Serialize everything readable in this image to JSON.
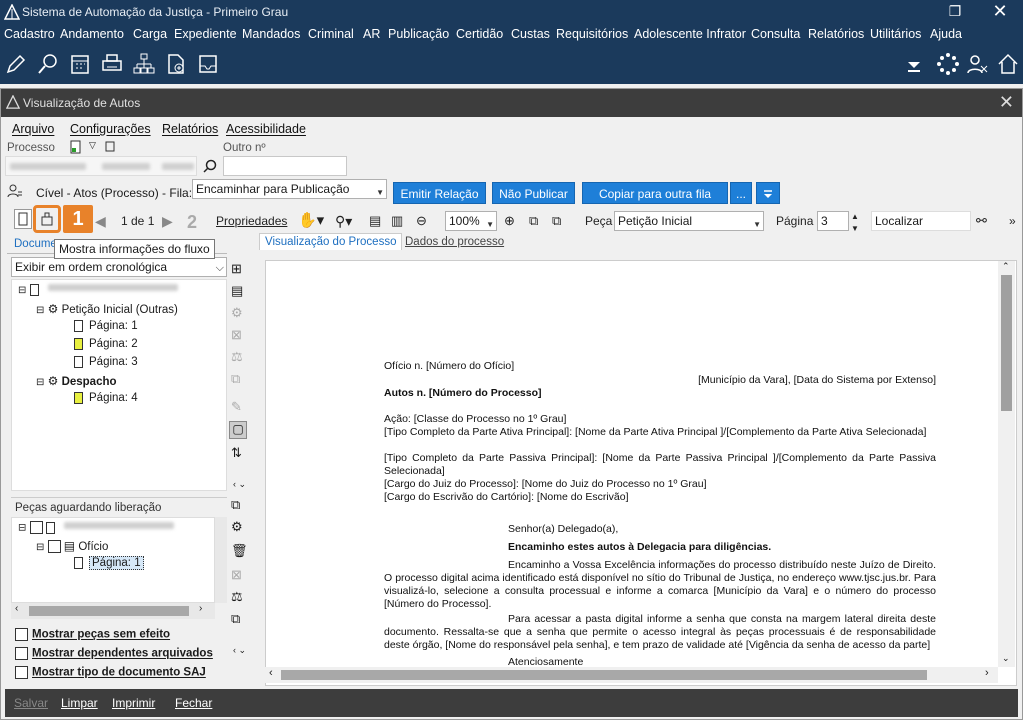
{
  "app": {
    "title": "Sistema de Automação da Justiça - Primeiro Grau"
  },
  "menubar": [
    "Cadastro",
    "Andamento",
    "Carga",
    "Expediente",
    "Mandados",
    "Criminal",
    "AR",
    "Publicação",
    "Certidão",
    "Custas",
    "Requisitórios",
    "Adolescente Infrator",
    "Consulta",
    "Relatórios",
    "Utilitários",
    "Ajuda"
  ],
  "window": {
    "title": "Visualização de Autos"
  },
  "submenu": [
    "Arquivo",
    "Configurações",
    "Relatórios",
    "Acessibilidade"
  ],
  "search": {
    "processo_label": "Processo",
    "outro_label": "Outro nº"
  },
  "fila": {
    "label": "Cível - Atos (Processo) - Fila:",
    "value": "Encaminhar para Publicação"
  },
  "actions": {
    "emitir": "Emitir Relação",
    "nao_publicar": "Não Publicar",
    "copiar": "Copiar para outra fila",
    "more": "..."
  },
  "toolbar": {
    "page_count": "1 de 1",
    "propriedades": "Propriedades",
    "zoom": "100%",
    "peca_label": "Peça",
    "peca_value": "Petição Inicial",
    "pagina_label": "Página",
    "pagina_value": "3",
    "localizar": "Localizar"
  },
  "callouts": {
    "one": "1",
    "two": "2"
  },
  "tooltip": "Mostra informações do fluxo",
  "tabs": {
    "left": "Documentos",
    "doc_view": "Visualização do Processo",
    "dados": "Dados do processo"
  },
  "order_select": "Exibir em ordem cronológica",
  "tree": {
    "peticao": "Petição Inicial (Outras)",
    "pagina1": "Página: 1",
    "pagina2": "Página: 2",
    "pagina3": "Página: 3",
    "despacho": "Despacho",
    "pagina4": "Página: 4"
  },
  "pending": {
    "title": "Peças aguardando liberação",
    "oficio": "Ofício",
    "pagina1": "Página: 1"
  },
  "checkboxes": {
    "sem_efeito": "Mostrar peças sem efeito",
    "dependentes": "Mostrar dependentes arquivados",
    "tipo_doc": "Mostrar tipo de documento SAJ"
  },
  "document": {
    "oficio": "Ofício n. [Número do Ofício]",
    "municipio": "[Município da Vara], [Data do Sistema por Extenso]",
    "autos": "Autos n. [Número do Processo]",
    "acao": "Ação: [Classe do Processo no 1º Grau]",
    "ativa": "[Tipo Completo da Parte Ativa Principal]: [Nome da Parte Ativa Principal ]/[Complemento da Parte Ativa Selecionada]",
    "passiva": "[Tipo Completo da Parte Passiva Principal]: [Nome da Parte Passiva Principal ]/[Complemento da Parte Passiva Selecionada]",
    "juiz": "[Cargo do Juiz do Processo]: [Nome do Juiz do Processo no 1º Grau]",
    "escrivao": "[Cargo do Escrivão do Cartório]: [Nome do Escrivão]",
    "saudacao": "Senhor(a) Delegado(a),",
    "encaminho": "Encaminho estes autos à Delegacia para diligências.",
    "par1": "Encaminho a Vossa Excelência informações do processo distribuído neste Juízo de Direito. O processo digital acima identificado está disponível no sítio do Tribunal de Justiça, no endereço www.tjsc.jus.br. Para visualizá-lo, selecione a consulta processual e informe a comarca [Município da Vara] e o número do processo [Número do Processo].",
    "par2": "Para acessar a pasta digital informe a senha que consta na margem lateral direita deste documento. Ressalta-se que a senha que permite o acesso integral às peças processuais é de responsabilidade deste órgão, [Nome do responsável pela senha], e tem prazo de validade até [Vigência da senha de acesso da parte]",
    "atenciosamente": "Atenciosamente"
  },
  "footer": {
    "salvar": "Salvar",
    "limpar": "Limpar",
    "imprimir": "Imprimir",
    "fechar": "Fechar"
  },
  "colors": {
    "navy": "#1b3a5c",
    "accent": "#1e7fd8",
    "callout": "#e8822a"
  }
}
